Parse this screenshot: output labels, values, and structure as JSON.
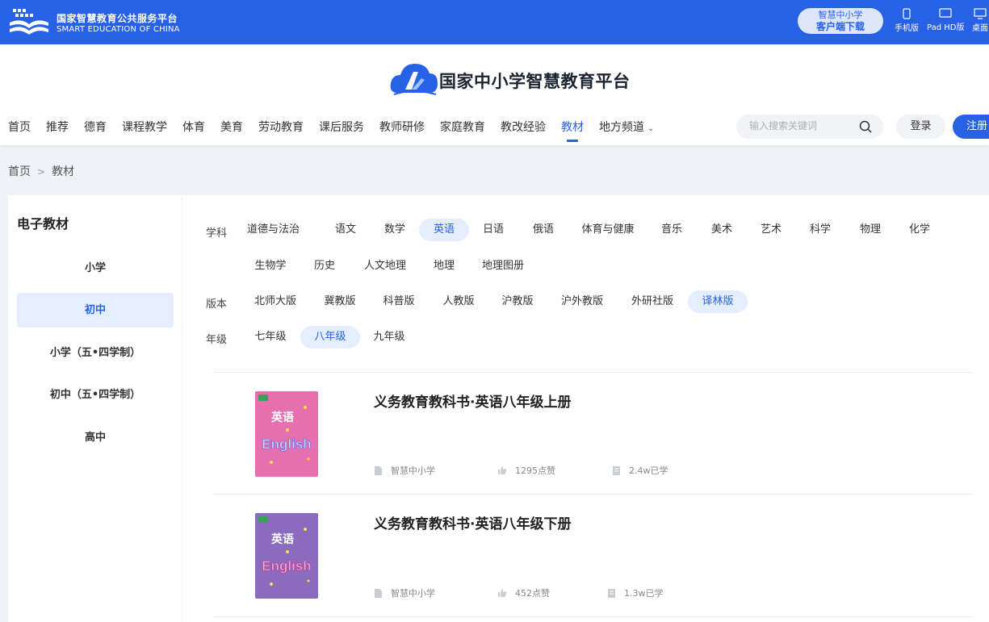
{
  "topbar": {
    "logo_cn": "国家智慧教育公共服务平台",
    "logo_en": "SMART EDUCATION OF CHINA",
    "download_line1": "智慧中小学",
    "download_line2": "客户端下载",
    "devices": [
      "手机版",
      "Pad HD版",
      "桌面"
    ]
  },
  "header": {
    "brand": "国家中小学智慧教育平台",
    "nav": [
      "首页",
      "推荐",
      "德育",
      "课程教学",
      "体育",
      "美育",
      "劳动教育",
      "课后服务",
      "教师研修",
      "家庭教育",
      "教改经验",
      "教材",
      "地方频道"
    ],
    "active_nav": "教材",
    "search_placeholder": "输入搜索关键词",
    "login": "登录",
    "register": "注册"
  },
  "breadcrumb": {
    "home": "首页",
    "sep": ">",
    "current": "教材"
  },
  "sidebar": {
    "title": "电子教材",
    "items": [
      "小学",
      "初中",
      "小学（五•四学制）",
      "初中（五•四学制）",
      "高中"
    ],
    "active": "初中"
  },
  "filters": {
    "subject_label": "学科",
    "subjects_row1": [
      "道德与法治",
      "语文",
      "数学",
      "英语",
      "日语",
      "俄语",
      "体育与健康",
      "音乐",
      "美术",
      "艺术",
      "科学",
      "物理",
      "化学"
    ],
    "subjects_row2": [
      "生物学",
      "历史",
      "人文地理",
      "地理",
      "地理图册"
    ],
    "subject_selected": "英语",
    "edition_label": "版本",
    "editions": [
      "北师大版",
      "冀教版",
      "科普版",
      "人教版",
      "沪教版",
      "沪外教版",
      "外研社版",
      "译林版"
    ],
    "edition_selected": "译林版",
    "grade_label": "年级",
    "grades": [
      "七年级",
      "八年级",
      "九年级"
    ],
    "grade_selected": "八年级"
  },
  "books": [
    {
      "title": "义务教育教科书·英语八年级上册",
      "publisher": "智慧中小学",
      "likes": "1295点赞",
      "learners": "2.4w已学",
      "cover_color": "#e05fa6",
      "cover_cn": "英语",
      "cover_en": "English"
    },
    {
      "title": "义务教育教科书·英语八年级下册",
      "publisher": "智慧中小学",
      "likes": "452点赞",
      "learners": "1.3w已学",
      "cover_color": "#8a6bbd",
      "cover_cn": "英语",
      "cover_en": "English"
    }
  ]
}
